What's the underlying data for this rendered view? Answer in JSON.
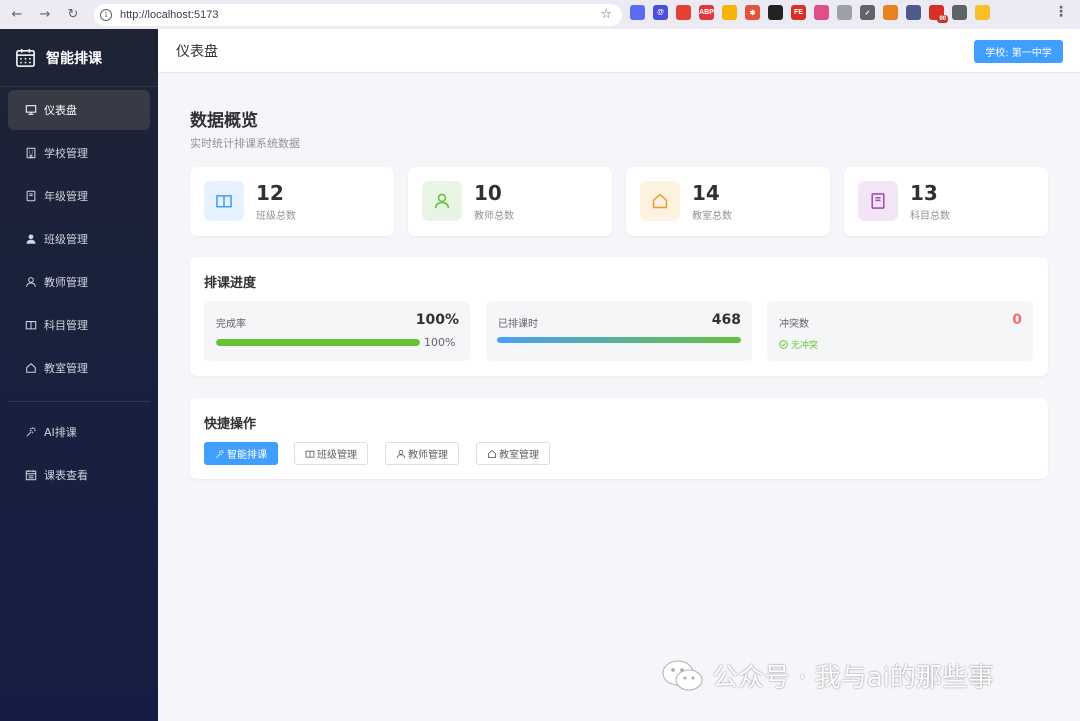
{
  "browser": {
    "url": "http://localhost:5173",
    "extensions": [
      {
        "name": "ext-blue-face",
        "color": "#5b6cf0",
        "label": ""
      },
      {
        "name": "ext-at",
        "color": "#4a4fdc",
        "label": "@"
      },
      {
        "name": "ext-chrome",
        "color": "#e34133",
        "label": ""
      },
      {
        "name": "ext-abp",
        "color": "#e0383e",
        "label": "ABP"
      },
      {
        "name": "ext-yellow",
        "color": "#f4b400",
        "label": ""
      },
      {
        "name": "ext-spark",
        "color": "#e5533c",
        "label": "✱"
      },
      {
        "name": "ext-black",
        "color": "#222222",
        "label": ""
      },
      {
        "name": "ext-fe",
        "color": "#d93025",
        "label": "FE"
      },
      {
        "name": "ext-pink",
        "color": "#e04f8b",
        "label": ""
      },
      {
        "name": "ext-gray-circle",
        "color": "#9aa0a6",
        "label": ""
      },
      {
        "name": "ext-check",
        "color": "#5f6368",
        "label": "✓"
      },
      {
        "name": "ext-fox",
        "color": "#e8821e",
        "label": ""
      },
      {
        "name": "ext-bird",
        "color": "#4d5b8c",
        "label": ""
      },
      {
        "name": "ext-red-badge",
        "color": "#d93025",
        "label": "",
        "badge": "90"
      },
      {
        "name": "ext-puzzle",
        "color": "#5f6368",
        "label": ""
      },
      {
        "name": "ext-profile",
        "color": "#f6c026",
        "label": ""
      }
    ]
  },
  "brand": {
    "name": "智能排课"
  },
  "sidebar": {
    "items": [
      {
        "label": "仪表盘",
        "icon": "monitor-icon",
        "active": true
      },
      {
        "label": "学校管理",
        "icon": "building-icon"
      },
      {
        "label": "年级管理",
        "icon": "notebook-icon"
      },
      {
        "label": "班级管理",
        "icon": "user-filled-icon"
      },
      {
        "label": "教师管理",
        "icon": "user-icon"
      },
      {
        "label": "科目管理",
        "icon": "book-icon"
      },
      {
        "label": "教室管理",
        "icon": "house-icon"
      }
    ],
    "tools": [
      {
        "label": "AI排课",
        "icon": "magic-stick-icon"
      },
      {
        "label": "课表查看",
        "icon": "calendar-icon"
      }
    ]
  },
  "header": {
    "title": "仪表盘",
    "school_button": "学校: 第一中学"
  },
  "overview": {
    "title": "数据概览",
    "subtitle": "实时统计排课系统数据",
    "stats": [
      {
        "value": "12",
        "label": "班级总数",
        "icon": "book-icon",
        "bg": "#e5f1fe",
        "fg": "#409eff"
      },
      {
        "value": "10",
        "label": "教师总数",
        "icon": "user-icon",
        "bg": "#e8f5e4",
        "fg": "#67c23a"
      },
      {
        "value": "14",
        "label": "教室总数",
        "icon": "house-icon",
        "bg": "#fdf2e0",
        "fg": "#e6a23c"
      },
      {
        "value": "13",
        "label": "科目总数",
        "icon": "notebook-icon",
        "bg": "#f4e5f6",
        "fg": "#a24fb3"
      }
    ]
  },
  "progress": {
    "title": "排课进度",
    "completion": {
      "label": "完成率",
      "value": "100%",
      "percent": 100,
      "percent_text": "100%"
    },
    "scheduled": {
      "label": "已排课时",
      "value": "468"
    },
    "conflicts": {
      "label": "冲突数",
      "value": "0",
      "status": "无冲突"
    }
  },
  "quick_actions": {
    "title": "快捷操作",
    "buttons": [
      {
        "label": "智能排课",
        "icon": "magic-stick-icon",
        "primary": true
      },
      {
        "label": "班级管理",
        "icon": "book-icon"
      },
      {
        "label": "教师管理",
        "icon": "user-icon"
      },
      {
        "label": "教室管理",
        "icon": "house-icon"
      }
    ]
  },
  "watermark": {
    "text": "公众号 · 我与ai的那些事"
  },
  "colors": {
    "primary": "#409eff",
    "success": "#67c23a",
    "danger": "#f56c6c",
    "sidebar": "#1d2434"
  }
}
